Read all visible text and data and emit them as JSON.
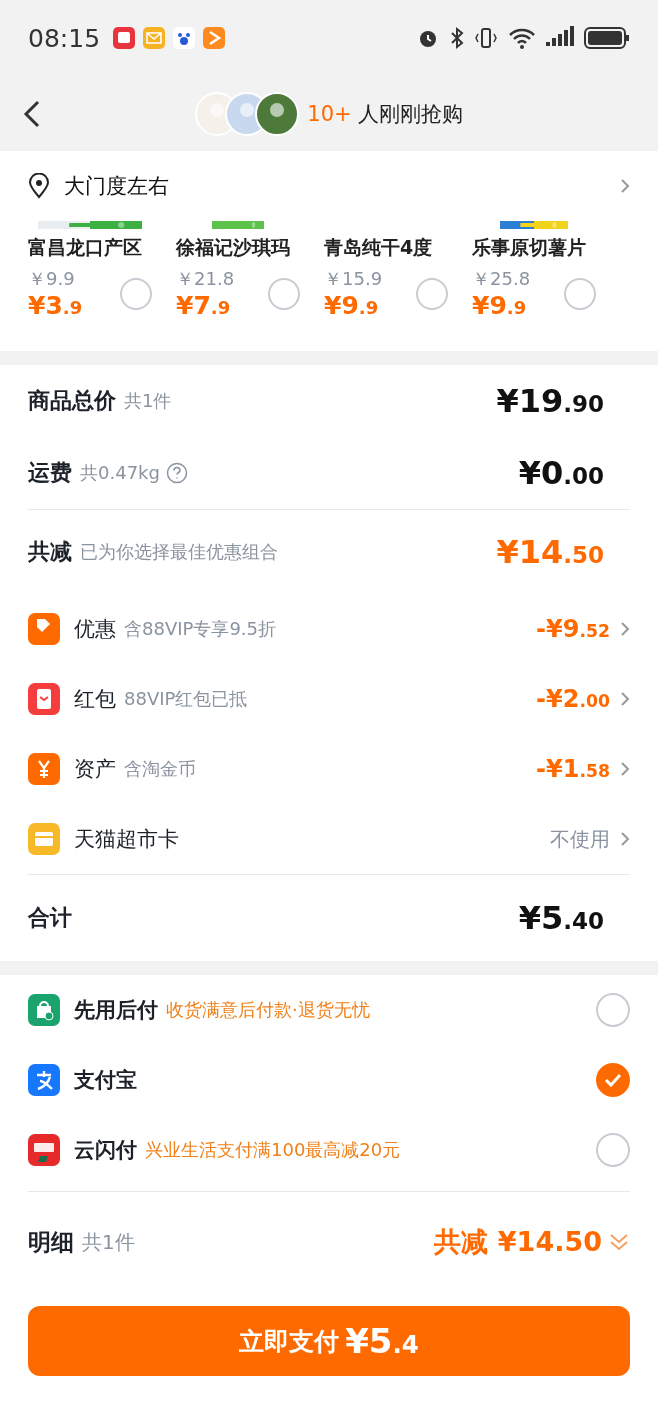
{
  "status_bar": {
    "time": "08:15"
  },
  "header": {
    "count": "10+",
    "text": "人刚刚抢购"
  },
  "address": {
    "text": "大门度左右"
  },
  "products": [
    {
      "name": "富昌龙口产区",
      "original_price": "￥9.9",
      "price": "¥3.9",
      "selected": false
    },
    {
      "name": "徐福记沙琪玛",
      "original_price": "￥21.8",
      "price": "¥7.9",
      "selected": false
    },
    {
      "name": "青岛纯干4度",
      "original_price": "￥15.9",
      "price": "¥9.9",
      "selected": false
    },
    {
      "name": "乐事原切薯片",
      "original_price": "￥25.8",
      "price": "¥9.9",
      "selected": false
    }
  ],
  "summary": [
    {
      "label": "商品总价",
      "note": "共1件",
      "value": "¥19.90",
      "kind": "total",
      "help": false
    },
    {
      "label": "运费",
      "note": "共0.47kg",
      "value": "¥0.00",
      "kind": "total",
      "help": true
    }
  ],
  "discount": {
    "label": "共减",
    "note": "已为你选择最佳优惠组合",
    "value": "¥14.50"
  },
  "discount_items": [
    {
      "label": "优惠",
      "note": "含88VIP专享9.5折",
      "value": "-¥9.52",
      "kind": "amount"
    },
    {
      "label": "红包",
      "note": "88VIP红包已抵",
      "value": "-¥2.00",
      "kind": "amount"
    },
    {
      "label": "资产",
      "note": "含淘金币",
      "value": "-¥1.58",
      "kind": "amount"
    },
    {
      "label": "天猫超市卡",
      "value": "不使用",
      "kind": "text"
    }
  ],
  "grand_total": {
    "label": "合计",
    "value": "¥5.40"
  },
  "payment_methods": [
    {
      "name": "先用后付",
      "note": "收货满意后付款·退货无忧",
      "selected": false
    },
    {
      "name": "支付宝",
      "selected": true
    },
    {
      "name": "云闪付",
      "note": "兴业生活支付满100最高减20元",
      "selected": false
    }
  ],
  "details": {
    "label": "明细",
    "note": "共1件",
    "saving": "共减 ¥14.50"
  },
  "pay_button": {
    "label": "立即支付",
    "price": "¥5.4"
  }
}
